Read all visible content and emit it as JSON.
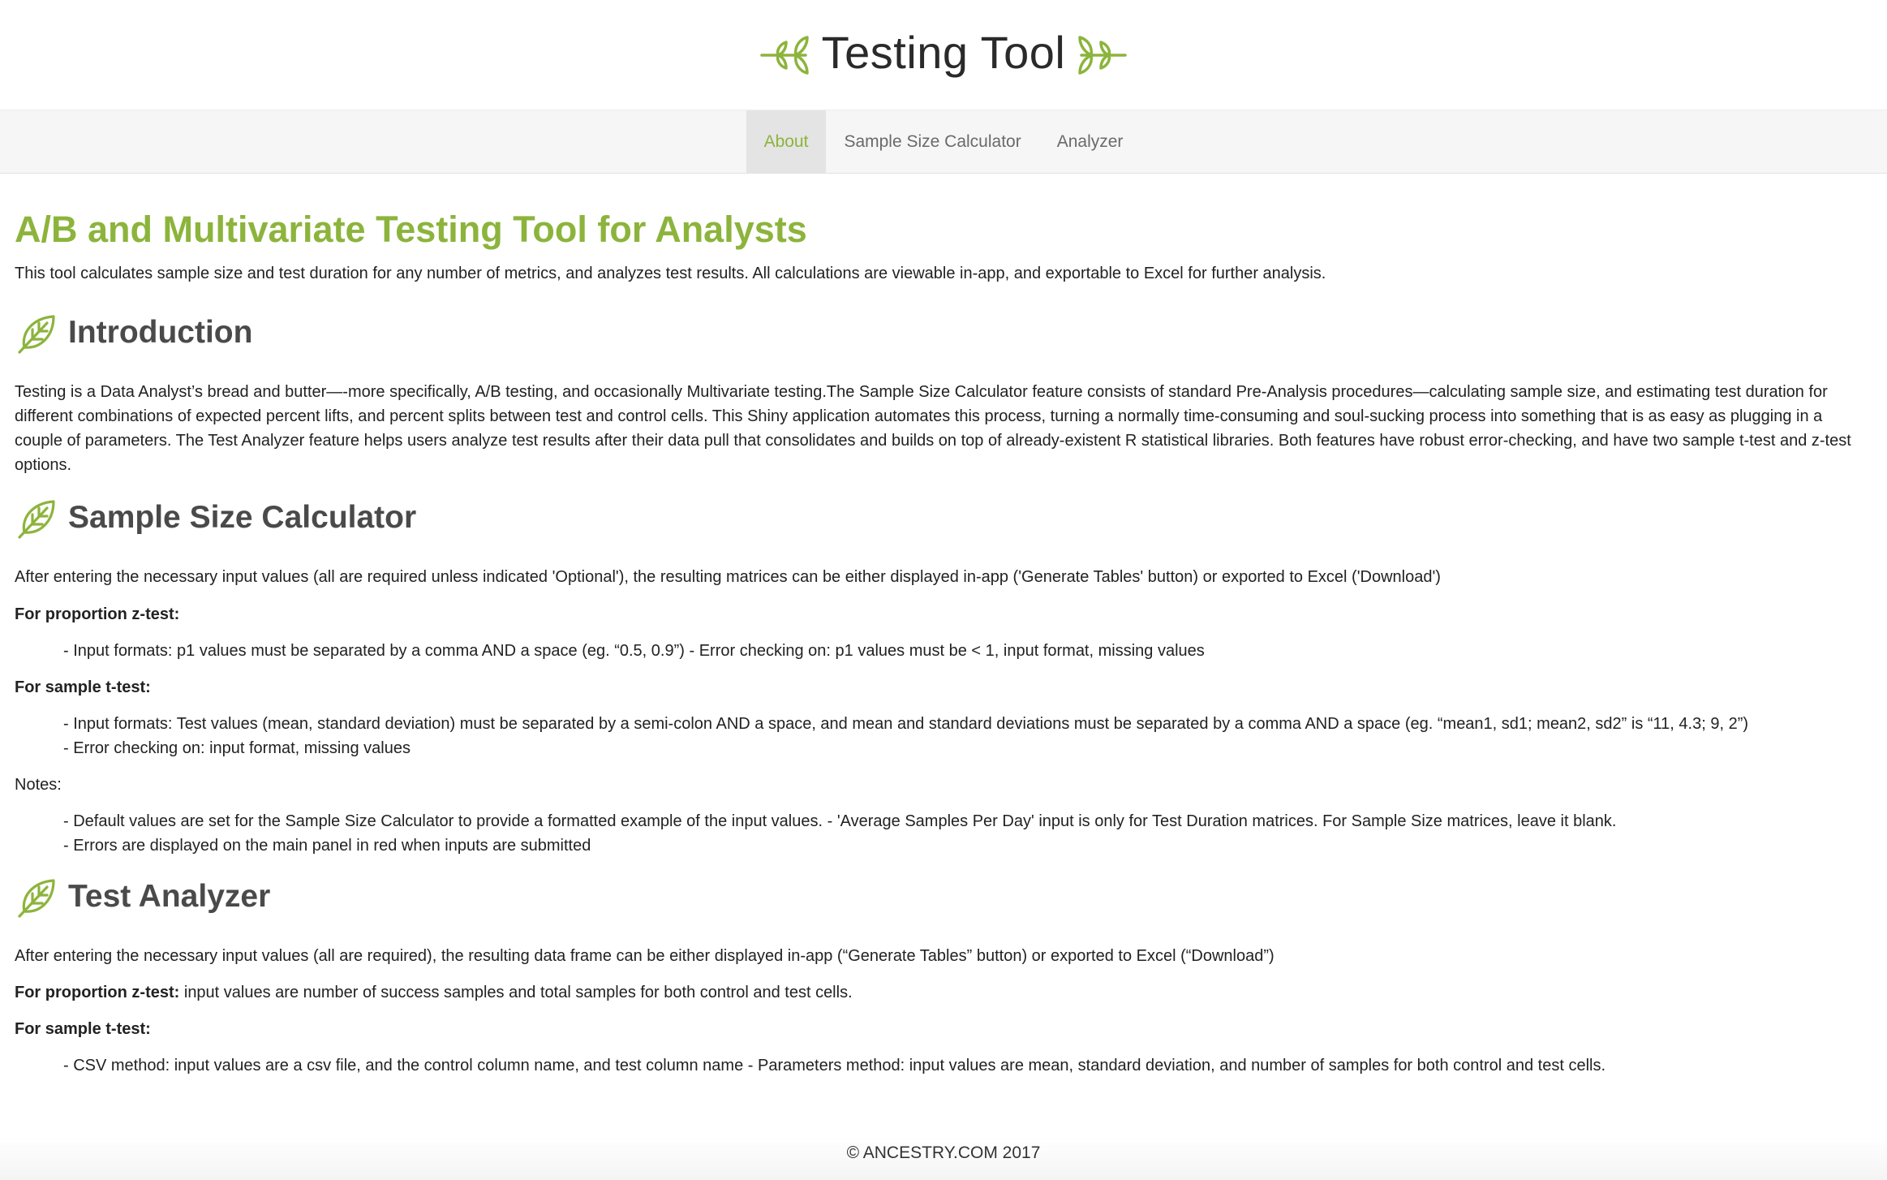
{
  "header": {
    "title": "Testing Tool",
    "left_icon": "leaf-branch-icon",
    "right_icon": "leaf-branch-icon",
    "accent_color": "#8cb43c"
  },
  "nav": {
    "tabs": [
      {
        "label": "About",
        "active": true
      },
      {
        "label": "Sample Size Calculator",
        "active": false
      },
      {
        "label": "Analyzer",
        "active": false
      }
    ]
  },
  "main": {
    "title": "A/B and Multivariate Testing Tool for Analysts",
    "subtitle": "This tool calculates sample size and test duration for any number of metrics, and analyzes test results. All calculations are viewable in-app, and exportable to Excel for further analysis."
  },
  "introduction": {
    "heading": "Introduction",
    "icon": "leaf-icon",
    "body": "Testing is a Data Analyst’s bread and butter—-more specifically, A/B testing, and occasionally Multivariate testing.The Sample Size Calculator feature consists of standard Pre-Analysis procedures—calculating sample size, and estimating test duration for different combinations of expected percent lifts, and percent splits between test and control cells. This Shiny application automates this process, turning a normally time-consuming and soul-sucking process into something that is as easy as plugging in a couple of parameters. The Test Analyzer feature helps users analyze test results after their data pull that consolidates and builds on top of already-existent R statistical libraries. Both features have robust error-checking, and have two sample t-test and z-test options."
  },
  "sample_size_calculator": {
    "heading": "Sample Size Calculator",
    "icon": "leaf-icon",
    "intro": "After entering the necessary input values (all are required unless indicated 'Optional'), the resulting matrices can be either displayed in-app ('Generate Tables' button) or exported to Excel ('Download')",
    "proportion_label": "For proportion z-test:",
    "proportion_line1": "- Input formats: p1 values must be separated by a comma AND a space (eg. “0.5, 0.9”) - Error checking on: p1 values must be < 1, input format, missing values",
    "ttest_label": "For sample t-test:",
    "ttest_line1": "- Input formats: Test values (mean, standard deviation) must be separated by a semi-colon AND a space, and mean and standard deviations must be separated by a comma AND a space (eg. “mean1, sd1; mean2, sd2” is “11, 4.3; 9, 2”)",
    "ttest_line2": "- Error checking on: input format, missing values",
    "notes_label": "Notes:",
    "notes_line1": "- Default values are set for the Sample Size Calculator to provide a formatted example of the input values. - 'Average Samples Per Day' input is only for Test Duration matrices. For Sample Size matrices, leave it blank.",
    "notes_line2": "- Errors are displayed on the main panel in red when inputs are submitted"
  },
  "test_analyzer": {
    "heading": "Test Analyzer",
    "icon": "leaf-icon",
    "intro": "After entering the necessary input values (all are required), the resulting data frame can be either displayed in-app (“Generate Tables” button) or exported to Excel (“Download”)",
    "proportion_label": "For proportion z-test:",
    "proportion_text": " input values are number of success samples and total samples for both control and test cells.",
    "ttest_label": "For sample t-test:",
    "ttest_line1": "- CSV method: input values are a csv file, and the control column name, and test column name - Parameters method: input values are mean, standard deviation, and number of samples for both control and test cells."
  },
  "footer": {
    "text": "© ANCESTRY.COM 2017"
  }
}
